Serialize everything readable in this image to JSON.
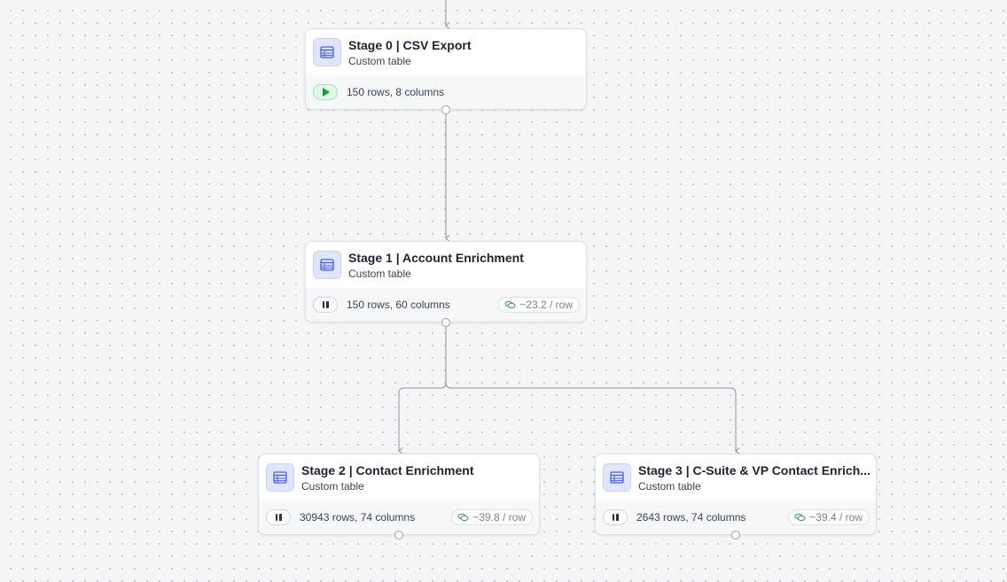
{
  "nodes": [
    {
      "title": "Stage 0 | CSV Export",
      "subtitle": "Custom table",
      "status": "play",
      "icon": "table-icon",
      "rows_text": "150 rows, 8 columns",
      "cost": ""
    },
    {
      "title": "Stage 1 | Account Enrichment",
      "subtitle": "Custom table",
      "status": "pause",
      "icon": "table-icon",
      "rows_text": "150 rows, 60 columns",
      "cost": "~23.2 / row"
    },
    {
      "title": "Stage 2 | Contact Enrichment",
      "subtitle": "Custom table",
      "status": "pause",
      "icon": "table-icon",
      "rows_text": "30943 rows, 74 columns",
      "cost": "~39.8 / row"
    },
    {
      "title": "Stage 3 | C-Suite & VP Contact Enrich...",
      "subtitle": "Custom table",
      "status": "pause",
      "icon": "table-icon",
      "rows_text": "2643 rows, 74 columns",
      "cost": "~39.4 / row"
    }
  ],
  "colors": {
    "canvas_bg": "#f4f5f7",
    "dot": "#c4c7cd",
    "edge": "#8e939b",
    "icon_blue": "#4a5fd1",
    "play_green": "#1a9a3a",
    "credit_green": "#3f8f5a"
  }
}
